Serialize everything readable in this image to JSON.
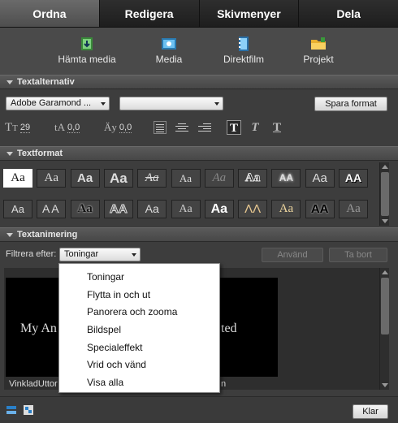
{
  "tabs": [
    {
      "label": "Ordna",
      "active": true
    },
    {
      "label": "Redigera"
    },
    {
      "label": "Skivmenyer"
    },
    {
      "label": "Dela"
    }
  ],
  "toolbar": {
    "items": [
      {
        "label": "Hämta media",
        "icon": "film-import-icon"
      },
      {
        "label": "Media",
        "icon": "media-icon"
      },
      {
        "label": "Direktfilm",
        "icon": "film-strip-icon"
      },
      {
        "label": "Projekt",
        "icon": "folder-icon"
      }
    ]
  },
  "text_options": {
    "title": "Textalternativ",
    "font": "Adobe Garamond ...",
    "style": "",
    "save_format": "Spara format",
    "font_size": "29",
    "leading": "0,0",
    "tracking": "0,0"
  },
  "text_format": {
    "title": "Textformat",
    "swatches_row1": [
      "Aa",
      "Aa",
      "Aa",
      "Aa",
      "Aa",
      "Aa",
      "Aa",
      "Aa",
      "AA",
      "Aa",
      "AA"
    ],
    "swatches_row2": [
      "Aa",
      "AA",
      "Aa",
      "AA",
      "Aa",
      "Aa",
      "Aa",
      "ΛΛ",
      "Aa",
      "AA",
      "Aa"
    ]
  },
  "text_animation": {
    "title": "Textanimering",
    "filter_label": "Filtrera efter:",
    "filter_value": "Toningar",
    "apply": "Använd",
    "remove": "Ta bort",
    "options": [
      "Toningar",
      "Flytta in och ut",
      "Panorera och zooma",
      "Bildspel",
      "Specialeffekt",
      "Vrid och vänd",
      "Visa alla"
    ],
    "preview_text_left": "My An",
    "preview_text_right": "ted",
    "caption_left": "VinkladUttor",
    "caption_right": "n"
  },
  "bottom": {
    "done": "Klar"
  },
  "colors": {
    "accent": "#4a4a4a",
    "active_tab": "#5a5a5a"
  }
}
